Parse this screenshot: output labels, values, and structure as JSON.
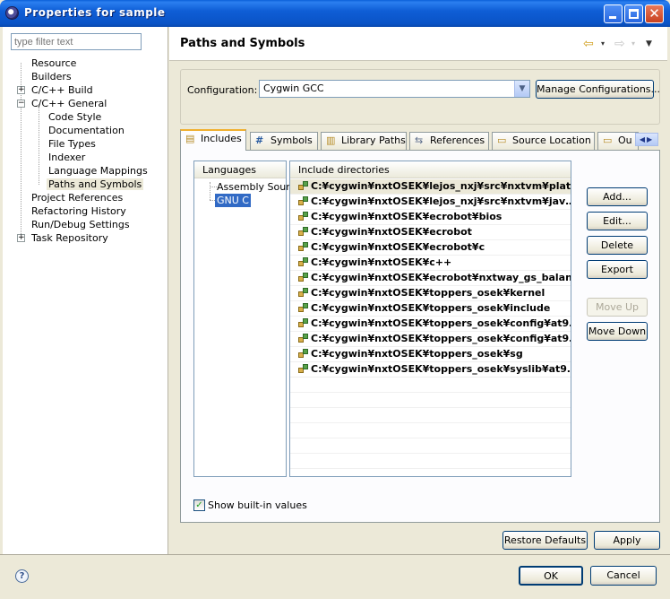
{
  "window": {
    "title": "Properties for sample"
  },
  "filter": {
    "placeholder": "type filter text"
  },
  "tree": {
    "items": [
      {
        "label": "Resource"
      },
      {
        "label": "Builders"
      },
      {
        "label": "C/C++ Build"
      },
      {
        "label": "C/C++ General"
      },
      {
        "label": "Code Style"
      },
      {
        "label": "Documentation"
      },
      {
        "label": "File Types"
      },
      {
        "label": "Indexer"
      },
      {
        "label": "Language Mappings"
      },
      {
        "label": "Paths and Symbols"
      },
      {
        "label": "Project References"
      },
      {
        "label": "Refactoring History"
      },
      {
        "label": "Run/Debug Settings"
      },
      {
        "label": "Task Repository"
      }
    ],
    "expand_plus": "+",
    "expand_minus": "−"
  },
  "header": {
    "title": "Paths and Symbols",
    "back_glyph": "⇦",
    "fwd_glyph": "⇨",
    "dropdown_glyph": "▾",
    "menu_glyph": "▼"
  },
  "config": {
    "label": "Configuration:",
    "value": "Cygwin GCC",
    "dropdown_glyph": "▼",
    "manage_button": "Manage Configurations..."
  },
  "tabs": [
    {
      "label": "Includes",
      "icon": "includes-icon",
      "glyph": "▤"
    },
    {
      "label": "Symbols",
      "icon": "symbols-icon",
      "glyph": "#"
    },
    {
      "label": "Library Paths",
      "icon": "library-icon",
      "glyph": "▥"
    },
    {
      "label": "References",
      "icon": "references-icon",
      "glyph": "⇆"
    },
    {
      "label": "Source Location",
      "icon": "folder-icon",
      "glyph": "▭"
    },
    {
      "label": "Ou",
      "icon": "folder-icon",
      "glyph": "▭"
    }
  ],
  "tab_scroll": "◀▶",
  "languages": {
    "header": "Languages",
    "items": [
      "Assembly Sour",
      "GNU C"
    ]
  },
  "includes": {
    "header": "Include directories",
    "items": [
      "C:¥cygwin¥nxtOSEK¥lejos_nxj¥src¥nxtvm¥plat…",
      "C:¥cygwin¥nxtOSEK¥lejos_nxj¥src¥nxtvm¥jav…",
      "C:¥cygwin¥nxtOSEK¥ecrobot¥bios",
      "C:¥cygwin¥nxtOSEK¥ecrobot",
      "C:¥cygwin¥nxtOSEK¥ecrobot¥c",
      "C:¥cygwin¥nxtOSEK¥c++",
      "C:¥cygwin¥nxtOSEK¥ecrobot¥nxtway_gs_balan…",
      "C:¥cygwin¥nxtOSEK¥toppers_osek¥kernel",
      "C:¥cygwin¥nxtOSEK¥toppers_osek¥include",
      "C:¥cygwin¥nxtOSEK¥toppers_osek¥config¥at9…",
      "C:¥cygwin¥nxtOSEK¥toppers_osek¥config¥at9…",
      "C:¥cygwin¥nxtOSEK¥toppers_osek¥sg",
      "C:¥cygwin¥nxtOSEK¥toppers_osek¥syslib¥at9…"
    ]
  },
  "side_buttons": {
    "add": "Add...",
    "edit": "Edit...",
    "delete": "Delete",
    "export": "Export",
    "move_up": "Move Up",
    "move_down": "Move Down"
  },
  "show_builtin": {
    "label": "Show built-in values",
    "checked": true,
    "check_glyph": "✓"
  },
  "bottom_buttons": {
    "restore": "Restore Defaults",
    "apply": "Apply"
  },
  "dialog_buttons": {
    "ok": "OK",
    "cancel": "Cancel"
  },
  "help_glyph": "?",
  "colors": {
    "title_bar": "#0a53c6",
    "selection": "#316ac5",
    "dialog_bg": "#ece9d8"
  }
}
